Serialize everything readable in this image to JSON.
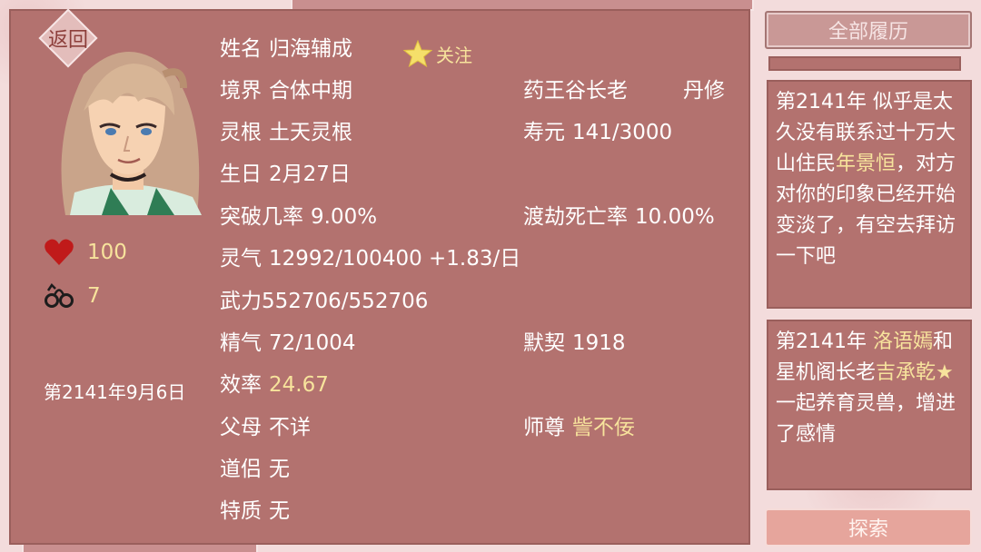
{
  "back_label": "返回",
  "follow_label": "关注",
  "stats": {
    "health": "100",
    "shackles": "7"
  },
  "side_date": "第2141年9月6日",
  "character": {
    "name_label": "姓名",
    "name": "归海辅成",
    "realm_label": "境界",
    "realm": "合体中期",
    "sect": "药王谷长老",
    "path": "丹修",
    "root_label": "灵根",
    "root": "土天灵根",
    "lifespan_label": "寿元",
    "lifespan": "141/3000",
    "birthday_label": "生日",
    "birthday": "2月27日",
    "breakthrough_label": "突破几率",
    "breakthrough": "9.00%",
    "tribulation_label": "渡劫死亡率",
    "tribulation": "10.00%",
    "qi_label": "灵气",
    "qi": "12992/100400 +1.83/日",
    "force_label": "武力",
    "force": "552706/552706",
    "essence_label": "精气",
    "essence": "72/1004",
    "rapport_label": "默契",
    "rapport": "1918",
    "efficiency_label": "效率",
    "efficiency": "24.67",
    "parents_label": "父母",
    "parents": "不详",
    "master_label": "师尊",
    "master": "訾不佞",
    "partner_label": "道侣",
    "partner": "无",
    "trait_label": "特质",
    "trait": "无"
  },
  "history_button": "全部履历",
  "events": [
    {
      "prefix": "第2141年 似乎是太久没有联系过十万大山住民",
      "name": "年景恒",
      "suffix": "，对方对你的印象已经开始变淡了，有空去拜访一下吧"
    },
    {
      "prefix": "第2141年 ",
      "name1": "洛语嫣",
      "mid": "和星机阁长老",
      "name2": "吉承乾",
      "star": "★",
      "suffix": "一起养育灵兽，增进了感情"
    }
  ],
  "explore_button": "探索",
  "colors": {
    "panel": "#b3726f",
    "highlight": "#f7e39c",
    "background": "#f3dcdc"
  }
}
